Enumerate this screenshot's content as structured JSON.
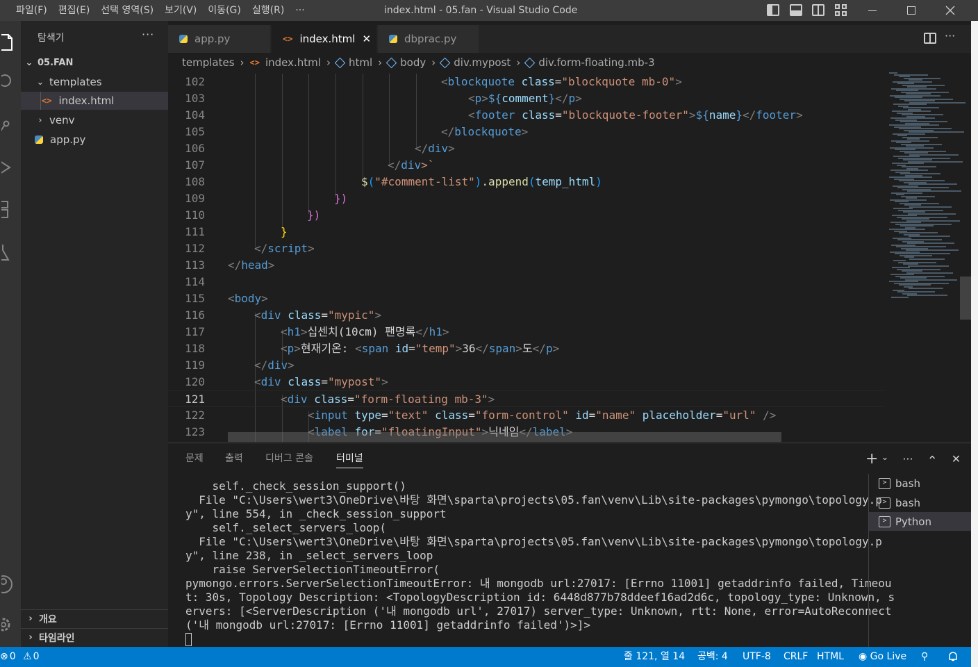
{
  "menu": [
    "파일(F)",
    "편집(E)",
    "선택 영역(S)",
    "보기(V)",
    "이동(G)",
    "실행(R)",
    "···"
  ],
  "window_title": "index.html - 05.fan - Visual Studio Code",
  "activity_icons": [
    "explorer-icon",
    "search-icon",
    "source-control-icon",
    "run-debug-icon",
    "extensions-icon",
    "testing-icon",
    "account-icon",
    "settings-gear-icon"
  ],
  "sidebar": {
    "title": "탐색기",
    "more": "···",
    "root": "05.FAN",
    "tree": [
      {
        "label": "templates",
        "chevron": "⌄"
      },
      {
        "label": "index.html",
        "icon": "<>"
      },
      {
        "label": "venv",
        "chevron": "›"
      },
      {
        "label": "app.py"
      }
    ],
    "sections": [
      "개요",
      "타임라인"
    ]
  },
  "tabs": [
    {
      "label": "app.py"
    },
    {
      "label": "index.html",
      "close": "✕"
    },
    {
      "label": "dbprac.py"
    }
  ],
  "breadcrumb": [
    "templates",
    "index.html",
    "html",
    "body",
    "div.mypost",
    "div.form-floating.mb-3"
  ],
  "code": [
    {
      "n": "102"
    },
    {
      "n": "103"
    },
    {
      "n": "104"
    },
    {
      "n": "105"
    },
    {
      "n": "106"
    },
    {
      "n": "107"
    },
    {
      "n": "108"
    },
    {
      "n": "109"
    },
    {
      "n": "110"
    },
    {
      "n": "111"
    },
    {
      "n": "112"
    },
    {
      "n": "113"
    },
    {
      "n": "114"
    },
    {
      "n": "115"
    },
    {
      "n": "116"
    },
    {
      "n": "117"
    },
    {
      "n": "118"
    },
    {
      "n": "119"
    },
    {
      "n": "120"
    },
    {
      "n": "121"
    },
    {
      "n": "122"
    },
    {
      "n": "123"
    }
  ],
  "code_text": {
    "l102a": "<",
    "l102b": "blockquote",
    "l102c": "class",
    "l102d": "=",
    "l102e": "\"blockquote mb-0\"",
    "l102f": ">",
    "l103a": "<",
    "l103b": "p",
    "l103c": ">",
    "l103d": "${",
    "l103e": "comment",
    "l103f": "}",
    "l103g": "</",
    "l103h": "p",
    "l103i": ">",
    "l104a": "<",
    "l104b": "footer",
    "l104c": "class",
    "l104d": "=",
    "l104e": "\"blockquote-footer\"",
    "l104f": ">",
    "l104g": "${",
    "l104h": "name",
    "l104i": "}",
    "l104j": "</",
    "l104k": "footer",
    "l104l": ">",
    "l105a": "</",
    "l105b": "blockquote",
    "l105c": ">",
    "l106a": "</",
    "l106b": "div",
    "l106c": ">",
    "l107a": "</",
    "l107b": "div",
    "l107c": ">`",
    "l108a": "$",
    "l108b": "(",
    "l108c": "\"#comment-list\"",
    "l108d": ")",
    "l108e": ".append",
    "l108f": "(",
    "l108g": "temp_html",
    "l108h": ")",
    "l109": "})",
    "l110": "})",
    "l111": "}",
    "l112a": "</",
    "l112b": "script",
    "l112c": ">",
    "l113a": "</",
    "l113b": "head",
    "l113c": ">",
    "l115a": "<",
    "l115b": "body",
    "l115c": ">",
    "l116a": "<",
    "l116b": "div",
    "l116c": "class",
    "l116d": "=",
    "l116e": "\"mypic\"",
    "l116f": ">",
    "l117a": "<",
    "l117b": "h1",
    "l117c": ">",
    "l117d": "십센치(10cm) 팬명록",
    "l117e": "</",
    "l117f": "h1",
    "l117g": ">",
    "l118a": "<",
    "l118b": "p",
    "l118c": ">",
    "l118d": "현재기온: ",
    "l118e": "<",
    "l118f": "span",
    "l118g": "id",
    "l118h": "=",
    "l118i": "\"temp\"",
    "l118j": ">",
    "l118k": "36",
    "l118l": "</",
    "l118m": "span",
    "l118n": ">",
    "l118o": "도",
    "l118p": "</",
    "l118q": "p",
    "l118r": ">",
    "l119a": "</",
    "l119b": "div",
    "l119c": ">",
    "l120a": "<",
    "l120b": "div",
    "l120c": "class",
    "l120d": "=",
    "l120e": "\"mypost\"",
    "l120f": ">",
    "l121a": "<",
    "l121b": "div",
    "l121c": "class",
    "l121d": "=",
    "l121e": "\"form-floating mb-3\"",
    "l121f": ">",
    "l122a": "<",
    "l122b": "input",
    "l122c": "type",
    "l122d": "=",
    "l122e": "\"text\"",
    "l122f": "class",
    "l122g": "=",
    "l122h": "\"form-control\"",
    "l122i": "id",
    "l122j": "=",
    "l122k": "\"name\"",
    "l122l": "placeholder",
    "l122m": "=",
    "l122n": "\"url\"",
    "l122o": "/>",
    "l123a": "<",
    "l123b": "label",
    "l123c": "for",
    "l123d": "=",
    "l123e": "\"floatingInput\"",
    "l123f": ">",
    "l123g": "닉네임",
    "l123h": "</",
    "l123i": "label",
    "l123j": ">"
  },
  "panel": {
    "tabs": [
      "문제",
      "출력",
      "디버그 콘솔",
      "터미널"
    ],
    "actions": {
      "add": "+",
      "chevron": "⌄",
      "more": "···",
      "maximize": "⌃",
      "close": "✕"
    },
    "terminal_lines": [
      "    self._check_session_support()",
      "  File \"C:\\Users\\wert3\\OneDrive\\바탕 화면\\sparta\\projects\\05.fan\\venv\\Lib\\site-packages\\pymongo\\topology.p",
      "y\", line 554, in _check_session_support",
      "    self._select_servers_loop(",
      "  File \"C:\\Users\\wert3\\OneDrive\\바탕 화면\\sparta\\projects\\05.fan\\venv\\Lib\\site-packages\\pymongo\\topology.p",
      "y\", line 238, in _select_servers_loop",
      "    raise ServerSelectionTimeoutError(",
      "pymongo.errors.ServerSelectionTimeoutError: 내 mongodb url:27017: [Errno 11001] getaddrinfo failed, Timeou",
      "t: 30s, Topology Description: <TopologyDescription id: 6448d877b78ddeef16ad2d6c, topology_type: Unknown, s",
      "ervers: [<ServerDescription ('내 mongodb url', 27017) server_type: Unknown, rtt: None, error=AutoReconnect",
      "('내 mongodb url:27017: [Errno 11001] getaddrinfo failed')>]>"
    ],
    "terminals": [
      "bash",
      "bash",
      "Python"
    ]
  },
  "statusbar": {
    "errors": "0",
    "warnings": "0",
    "position": "줄 121, 열 14",
    "indent": "공백: 4",
    "encoding": "UTF-8",
    "eol": "CRLF",
    "language": "HTML",
    "golive": "Go Live"
  },
  "colors": {
    "accent": "#007acc",
    "tag": "#569cd6",
    "attr": "#9cdcfe",
    "string": "#ce9178",
    "bracket_gold": "#ffd700",
    "bracket_orchid": "#da70d6"
  }
}
